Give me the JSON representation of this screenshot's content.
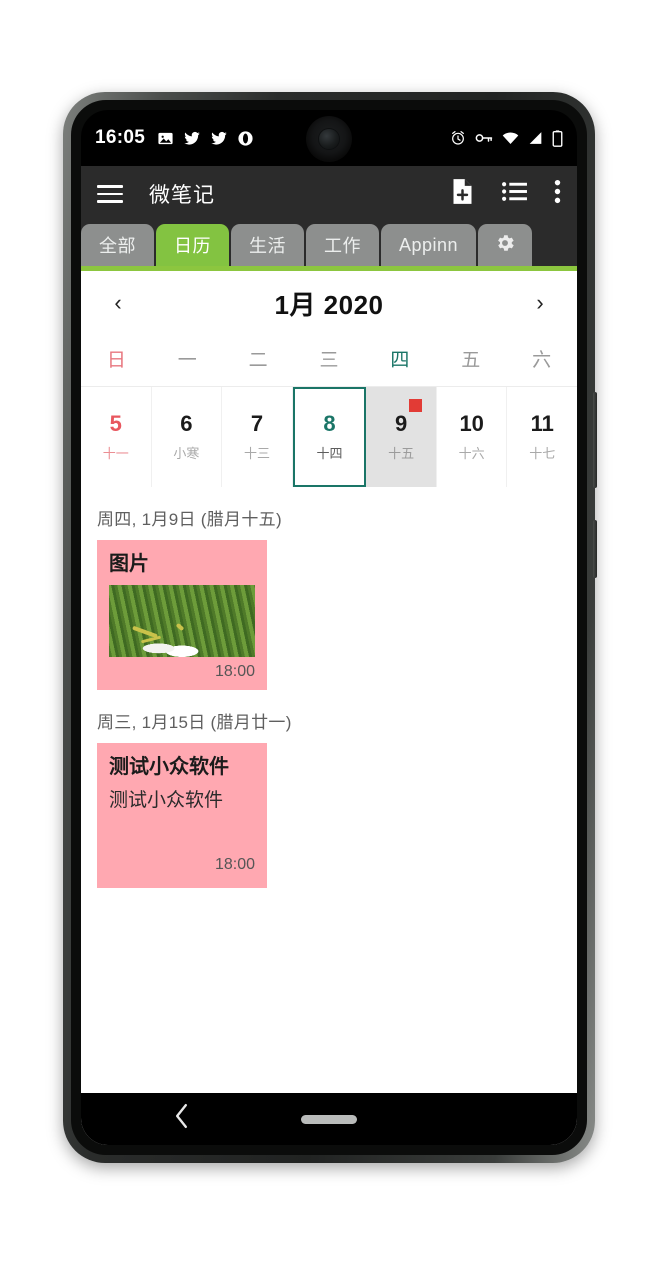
{
  "statusbar": {
    "time": "16:05",
    "left_icons": [
      "image-icon",
      "twitter-icon",
      "twitter-icon",
      "opera-icon"
    ],
    "right_icons": [
      "alarm-icon",
      "vpn-key-icon",
      "wifi-icon",
      "signal-icon",
      "battery-icon"
    ]
  },
  "appbar": {
    "menu_icon": "hamburger-menu-icon",
    "title": "微笔记",
    "actions": [
      {
        "icon": "new-note-icon"
      },
      {
        "icon": "list-view-icon"
      },
      {
        "icon": "overflow-menu-icon"
      }
    ]
  },
  "tabs": {
    "items": [
      {
        "label": "全部",
        "active": false
      },
      {
        "label": "日历",
        "active": true
      },
      {
        "label": "生活",
        "active": false
      },
      {
        "label": "工作",
        "active": false
      },
      {
        "label": "Appinn",
        "active": false
      }
    ],
    "settings_icon": "gear-icon",
    "active_color": "#83c341",
    "inactive_color": "#8d8f8e",
    "underline_color": "#8cc63f"
  },
  "calendar": {
    "prev_label": "‹",
    "next_label": "›",
    "title": "1月 2020",
    "weekdays": [
      "日",
      "一",
      "二",
      "三",
      "四",
      "五",
      "六"
    ],
    "days": [
      {
        "num": "5",
        "lunar": "十一",
        "sunday": true,
        "today": false,
        "selected": false,
        "event": false
      },
      {
        "num": "6",
        "lunar": "小寒",
        "sunday": false,
        "today": false,
        "selected": false,
        "event": false
      },
      {
        "num": "7",
        "lunar": "十三",
        "sunday": false,
        "today": false,
        "selected": false,
        "event": false
      },
      {
        "num": "8",
        "lunar": "十四",
        "sunday": false,
        "today": true,
        "selected": false,
        "event": false
      },
      {
        "num": "9",
        "lunar": "十五",
        "sunday": false,
        "today": false,
        "selected": true,
        "event": true
      },
      {
        "num": "10",
        "lunar": "十六",
        "sunday": false,
        "today": false,
        "selected": false,
        "event": false
      },
      {
        "num": "11",
        "lunar": "十七",
        "sunday": false,
        "today": false,
        "selected": false,
        "event": false
      }
    ],
    "today_color": "#1a7567",
    "sunday_color": "#e8575f",
    "selected_bg": "#e2e2e2",
    "event_dot_color": "#e23b35"
  },
  "notes": {
    "card_color": "#ffa8b1",
    "groups": [
      {
        "date_label": "周四, 1月9日 (腊月十五)",
        "items": [
          {
            "title": "图片",
            "body": "",
            "has_image": true,
            "image_alt": "grass-photo",
            "time": "18:00"
          }
        ]
      },
      {
        "date_label": "周三, 1月15日 (腊月廿一)",
        "items": [
          {
            "title": "测试小众软件",
            "body": "测试小众软件",
            "has_image": false,
            "time": "18:00"
          }
        ]
      }
    ]
  },
  "navbar": {
    "back_icon": "back-chevron-icon",
    "home_pill": "gesture-home-pill"
  }
}
